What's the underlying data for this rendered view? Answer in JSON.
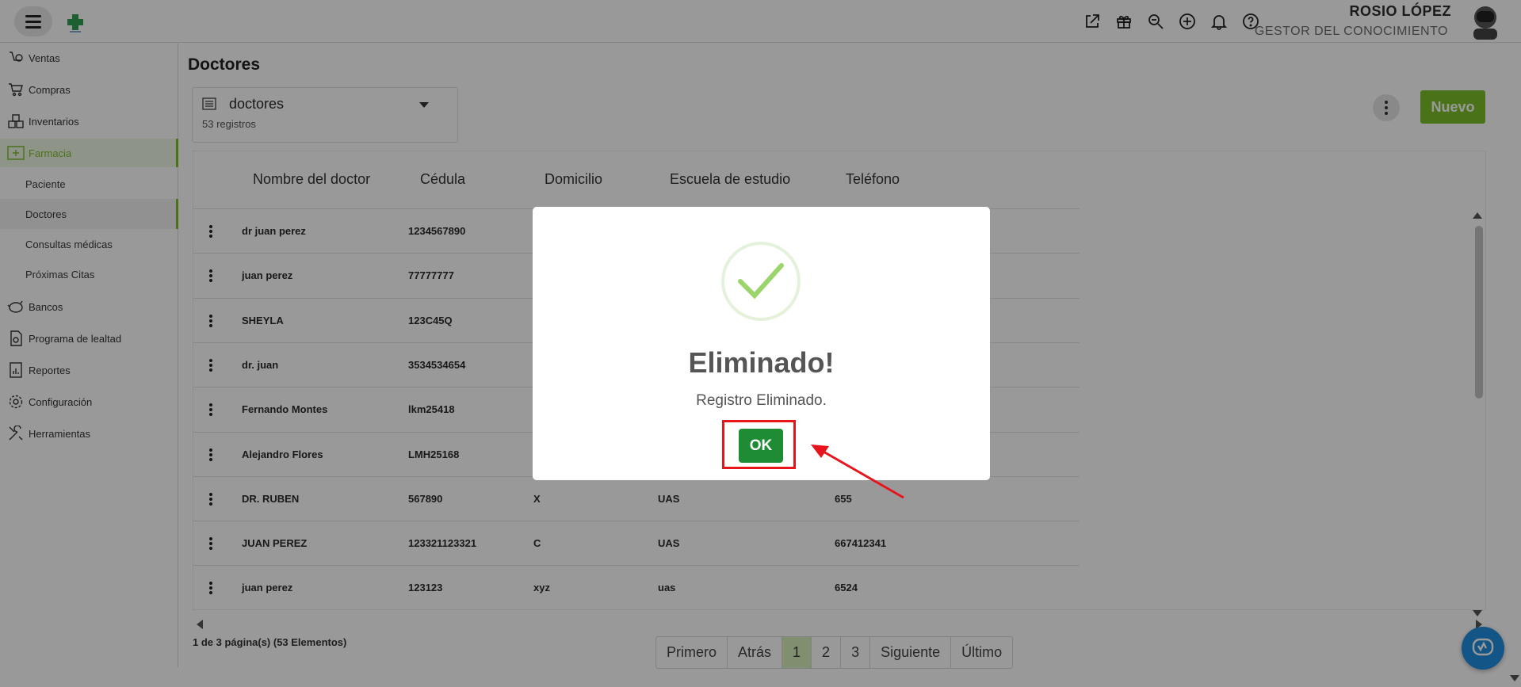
{
  "header": {
    "icons": [
      "external-link-icon",
      "gift-icon",
      "search-zoom-icon",
      "plus-circle-icon",
      "bell-icon",
      "help-icon"
    ],
    "user_name": "ROSIO LÓPEZ",
    "user_role": "GESTOR DEL CONOCIMIENTO"
  },
  "sidebar": {
    "items": [
      {
        "label": "Ventas",
        "icon": "sales-icon"
      },
      {
        "label": "Compras",
        "icon": "cart-icon"
      },
      {
        "label": "Inventarios",
        "icon": "inventory-icon"
      },
      {
        "label": "Farmacia",
        "icon": "pharmacy-icon"
      },
      {
        "label": "Bancos",
        "icon": "bank-icon"
      },
      {
        "label": "Programa de lealtad",
        "icon": "loyalty-icon"
      },
      {
        "label": "Reportes",
        "icon": "report-icon"
      },
      {
        "label": "Configuración",
        "icon": "gear-icon"
      },
      {
        "label": "Herramientas",
        "icon": "tools-icon"
      }
    ],
    "sub_items": [
      {
        "label": "Paciente"
      },
      {
        "label": "Doctores"
      },
      {
        "label": "Consultas médicas"
      },
      {
        "label": "Próximas Citas"
      }
    ]
  },
  "main": {
    "title": "Doctores",
    "selector": {
      "name": "doctores",
      "count": "53 registros"
    },
    "new_button": "Nuevo",
    "columns": [
      "Nombre del doctor",
      "Cédula",
      "Domicilio",
      "Escuela de estudio",
      "Teléfono"
    ],
    "rows": [
      [
        "dr juan perez",
        "1234567890",
        "",
        "",
        ""
      ],
      [
        "juan perez",
        "77777777",
        "",
        "",
        ""
      ],
      [
        "SHEYLA",
        "123C45Q",
        "",
        "",
        ""
      ],
      [
        "dr. juan",
        "3534534654",
        "",
        "",
        ""
      ],
      [
        "Fernando Montes",
        "lkm25418",
        "",
        "",
        ""
      ],
      [
        "Alejandro Flores",
        "LMH25168",
        "",
        "",
        ""
      ],
      [
        "DR. RUBEN",
        "567890",
        "X",
        "UAS",
        "655"
      ],
      [
        "JUAN PEREZ",
        "123321123321",
        "C",
        "UAS",
        "667412341"
      ],
      [
        "juan perez",
        "123123",
        "xyz",
        "uas",
        "6524"
      ]
    ],
    "page_info": "1 de 3 página(s) (53 Elementos)",
    "pager": [
      "Primero",
      "Atrás",
      "1",
      "2",
      "3",
      "Siguiente",
      "Último"
    ],
    "active_page": "1"
  },
  "modal": {
    "title": "Eliminado!",
    "text": "Registro Eliminado.",
    "ok_label": "OK"
  },
  "colors": {
    "accent": "#7cbf2a",
    "ok_button": "#1e8c34",
    "annotation": "#e8141c"
  }
}
